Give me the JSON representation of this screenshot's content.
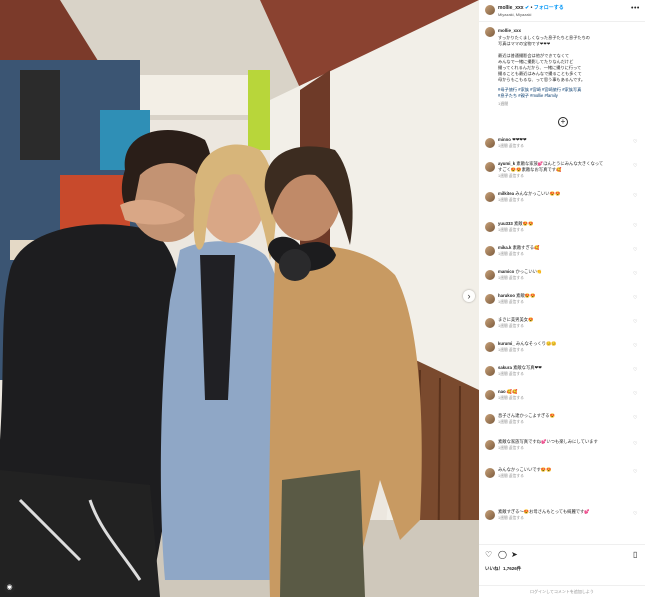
{
  "header": {
    "username": "mollie_xxx",
    "verified_icon": "verified-badge-icon",
    "follow_label": "フォローする",
    "location": "Miyazaki, Miyazaki",
    "more_icon": "more-options-icon"
  },
  "caption": {
    "username": "mollie_xxx",
    "lines": [
      "すっかりたくましくなった息子たちと息子たちの",
      "写真はママの宝物です❤❤❤",
      "",
      "最近は普通撮影会は他ができてなくて",
      "みんなで一緒に撮影してたりなんだけど",
      "撮ってくれるんだから、一緒に撮りに行って",
      "撮ることも最近はみんなで撮ることも多くて",
      "母からもこもるな、って思う事もあるんです。"
    ],
    "tags": [
      "#母子旅行 #家族 #宮崎 #宮崎旅行 #家族写真",
      "#息子たち #親子 #mollie #family"
    ],
    "time": "1週間"
  },
  "load_more_icon": "plus-circle-icon",
  "comments": [
    {
      "user": "minno",
      "text": "❤❤❤❤",
      "meta": "1週間  返信する"
    },
    {
      "user": "ayumi_k",
      "text": "素敵な家族💕ほんとうにみんな大きくなって",
      "meta": "1週間  返信する"
    },
    {
      "user": "",
      "text": "すごく😍😍素敵なお写真です🥰",
      "meta": "1週間  いいね！1件  返信する"
    },
    {
      "user": "milkitea",
      "text": "みんなかっこいい😍😍",
      "meta": "1週間  返信する"
    },
    {
      "user": "yuu333",
      "text": "素敵😍😍",
      "meta": "1週間  返信する"
    },
    {
      "user": "",
      "text": "",
      "meta": "1週間  返信する"
    },
    {
      "user": "mika.k",
      "text": "素敵すぎる🥰",
      "meta": "1週間  返信する"
    },
    {
      "user": "mamico",
      "text": "かっこいい👏",
      "meta": "1週間  返信する"
    },
    {
      "user": "harukoo",
      "text": "素敵😍😍",
      "meta": "1週間  返信する"
    },
    {
      "user": "",
      "text": "まさに美男美女😍",
      "meta": "1週間  返信する"
    },
    {
      "user": "kurumi_",
      "text": "みんなそっくり😊😊",
      "meta": "1週間  返信する"
    },
    {
      "user": "sakura",
      "text": "素敵な写真❤❤",
      "meta": "1週間  返信する"
    },
    {
      "user": "nao",
      "text": "🥰🥰",
      "meta": "1週間  返信する"
    },
    {
      "user": "",
      "text": "息子さん達かっこよすぎる😍",
      "meta": "1週間  返信する"
    },
    {
      "user": "",
      "text": "素敵な家族写真ですね💕いつも楽しみにしています",
      "meta": "1週間  返信する"
    },
    {
      "user": "",
      "text": "みんなかっこいいです😍😍",
      "meta": "1週間  返信する"
    },
    {
      "user": "",
      "text": "素敵すぎる〜😍お母さんもとっても綺麗です💕",
      "meta": "1週間  返信する"
    }
  ],
  "actions": {
    "like_icon": "heart-icon",
    "comment_icon": "comment-icon",
    "share_icon": "share-icon",
    "save_icon": "bookmark-icon"
  },
  "likes": "いいね！1,7626件",
  "add_comment_placeholder": "ログインしてコメントを追加しよう",
  "photo_icons": {
    "next_icon": "chevron-right-icon",
    "tag_icon": "user-tag-icon"
  },
  "colors": {
    "link_blue": "#0095f6",
    "hashtag": "#00376b",
    "secondary_text": "#8e8e8e"
  }
}
